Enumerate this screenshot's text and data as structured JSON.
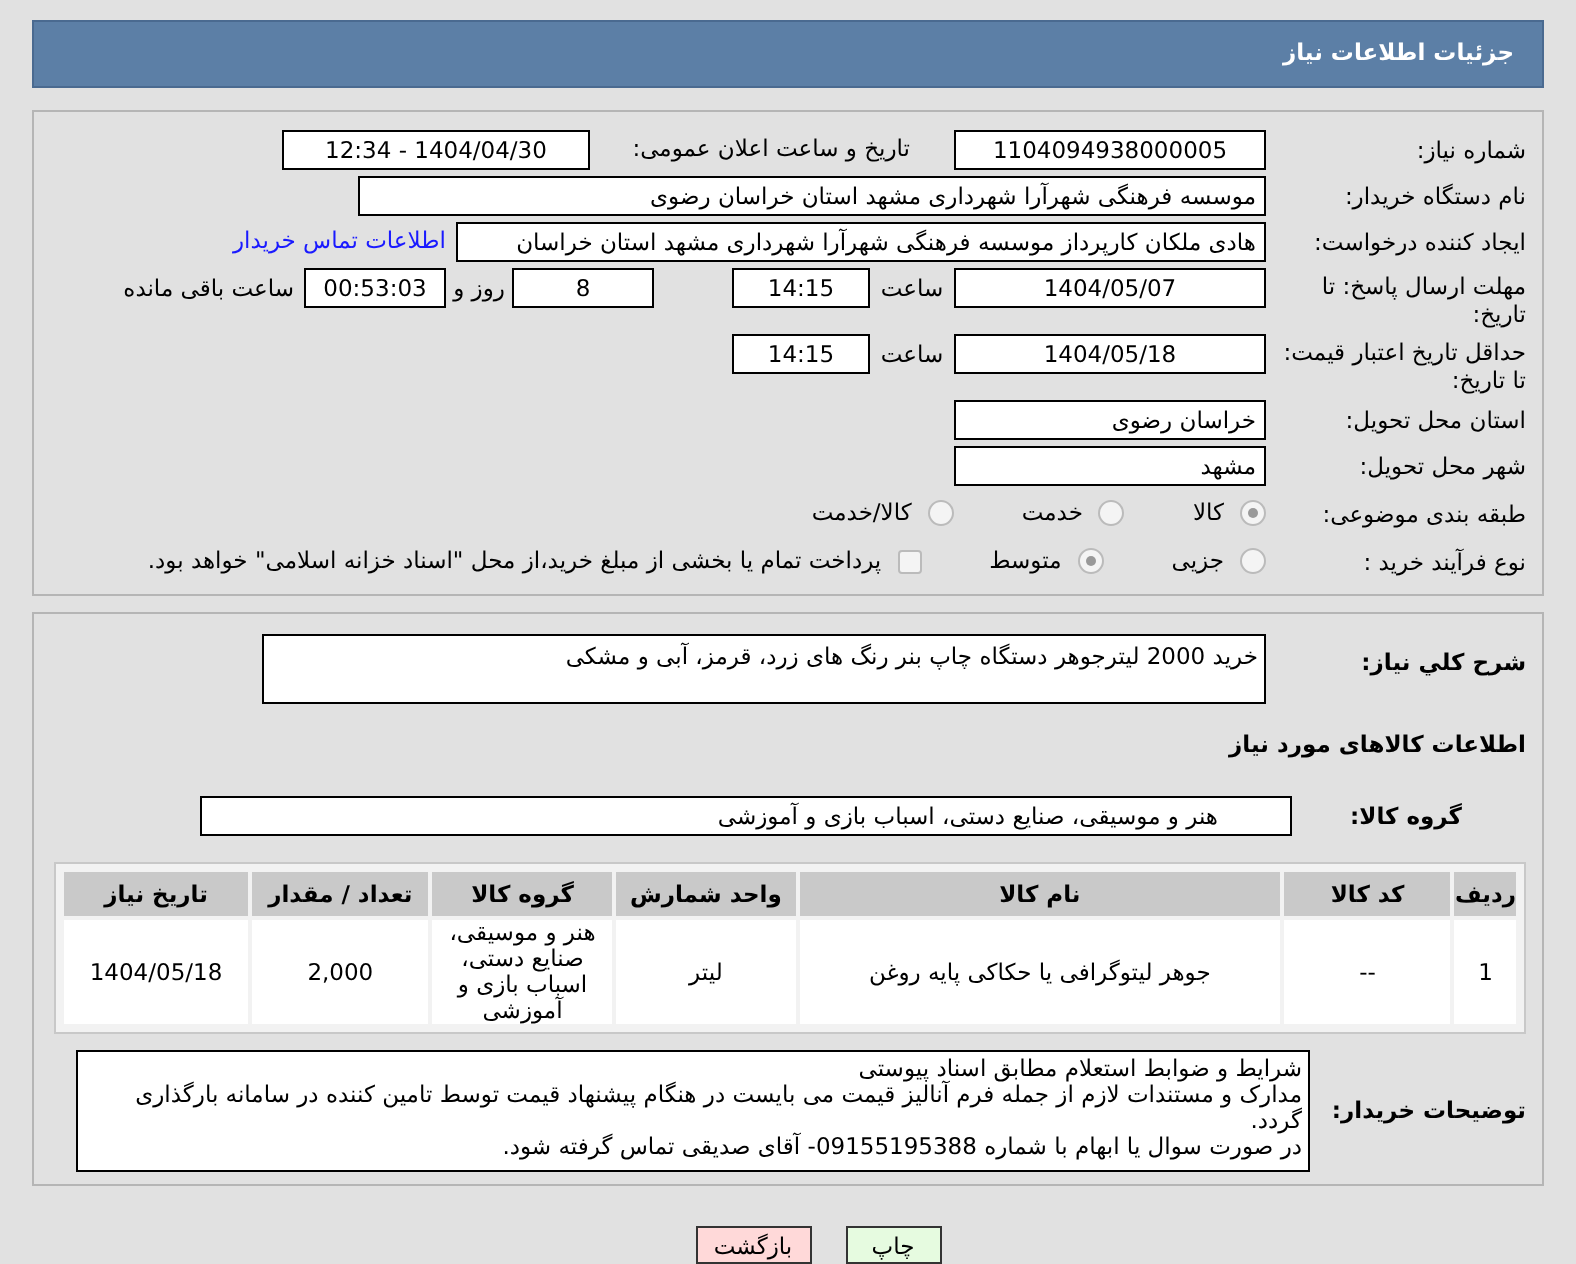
{
  "header": {
    "title": "جزئیات اطلاعات نیاز"
  },
  "need_number": {
    "label": "شماره نیاز:",
    "value": "1104094938000005"
  },
  "announce": {
    "label": "تاریخ و ساعت اعلان عمومی:",
    "value": "1404/04/30 - 12:34"
  },
  "buyer": {
    "label": "نام دستگاه خریدار:",
    "value": "موسسه فرهنگی شهرآرا شهرداری مشهد استان خراسان رضوی"
  },
  "creator": {
    "label": "ایجاد کننده درخواست:",
    "value": "هادی ملکان کارپرداز موسسه فرهنگی شهرآرا شهرداری مشهد استان خراسان",
    "link": "اطلاعات تماس خریدار"
  },
  "deadline": {
    "label": "مهلت ارسال پاسخ: تا تاریخ:",
    "date": "1404/05/07",
    "time_label": "ساعت",
    "time": "14:15",
    "days": "8",
    "days_label": "روز و",
    "remaining": "00:53:03",
    "remaining_label": "ساعت باقی مانده"
  },
  "validity": {
    "label": "حداقل تاریخ اعتبار قیمت: تا تاریخ:",
    "date": "1404/05/18",
    "time_label": "ساعت",
    "time": "14:15"
  },
  "province": {
    "label": "استان محل تحویل:",
    "value": "خراسان رضوی"
  },
  "city": {
    "label": "شهر محل تحویل:",
    "value": "مشهد"
  },
  "category": {
    "label": "طبقه بندی موضوعی:",
    "options": [
      {
        "label": "کالا",
        "selected": true
      },
      {
        "label": "خدمت",
        "selected": false
      },
      {
        "label": "کالا/خدمت",
        "selected": false
      }
    ]
  },
  "process": {
    "label": "نوع فرآیند خرید :",
    "options": [
      {
        "label": "جزیی",
        "selected": false
      },
      {
        "label": "متوسط",
        "selected": true
      }
    ],
    "payment": {
      "label": "پرداخت تمام یا بخشی از مبلغ خرید،از محل \"اسناد خزانه اسلامی\" خواهد بود.",
      "checked": false
    }
  },
  "summary": {
    "label": "شرح کلي نياز:",
    "value": "خرید 2000 لیترجوهر دستگاه چاپ بنر رنگ های زرد، قرمز، آبی و مشکی"
  },
  "goods_heading": "اطلاعات کالاهای مورد نیاز",
  "goods_group": {
    "label": "گروه کالا:",
    "value": "هنر و موسیقی، صنایع دستی، اسباب بازی و آموزشی"
  },
  "table": {
    "columns": [
      "ردیف",
      "کد کالا",
      "نام کالا",
      "واحد شمارش",
      "گروه کالا",
      "تعداد / مقدار",
      "تاریخ نیاز"
    ],
    "rows": [
      [
        "1",
        "--",
        "جوهر لیتوگرافی یا حکاکی پایه روغن",
        "لیتر",
        "هنر و موسیقی، صنایع دستی، اسباب بازی و آموزشی",
        "2,000",
        "1404/05/18"
      ]
    ]
  },
  "notes": {
    "label": "توضیحات خریدار:",
    "lines": [
      "شرایط و ضوابط استعلام مطابق اسناد پیوستی",
      "مدارک و مستندات لازم از جمله فرم آنالیز قیمت می بایست در هنگام پیشنهاد قیمت توسط تامین کننده در سامانه بارگذاری گردد.",
      "در صورت سوال یا ابهام با شماره 09155195388- آقای صدیقی تماس گرفته شود."
    ]
  },
  "buttons": [
    {
      "label": "چاپ",
      "kind": "print"
    },
    {
      "label": "بازگشت",
      "kind": "back"
    }
  ]
}
